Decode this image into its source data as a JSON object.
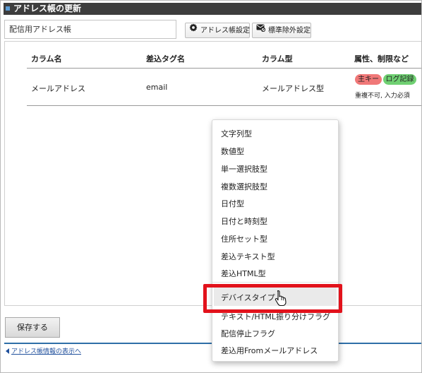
{
  "title": "アドレス帳の更新",
  "address_book_name": "配信用アドレス帳",
  "toolbar": {
    "address_book_settings": "アドレス帳設定",
    "standard_exclusion_settings": "標準除外設定"
  },
  "table": {
    "headers": [
      "カラム名",
      "差込タグ名",
      "カラム型",
      "属性、制限など"
    ],
    "row": {
      "column_name": "メールアドレス",
      "tag_name": "email",
      "column_type": "メールアドレス型",
      "badges": [
        "主キー",
        "ログ記録"
      ],
      "note": "重複不可, 入力必須"
    }
  },
  "dropdown": {
    "items": [
      "文字列型",
      "数値型",
      "単一選択肢型",
      "複数選択肢型",
      "日付型",
      "日付と時刻型",
      "住所セット型",
      "差込テキスト型",
      "差込HTML型",
      "デバイスタイプ",
      "テキスト/HTML振り分けフラグ",
      "配信停止フラグ",
      "差込用Fromメールアドレス"
    ],
    "highlighted": "デバイスタイプ"
  },
  "save_button": "保存する",
  "back_link": "アドレス帳情報の表示へ",
  "colors": {
    "title_bar": "#3d3d3d",
    "badge_primary_key": "#f07878",
    "badge_log": "#6fd072",
    "highlight_box": "#e2121b",
    "link": "#1f4f9c"
  }
}
